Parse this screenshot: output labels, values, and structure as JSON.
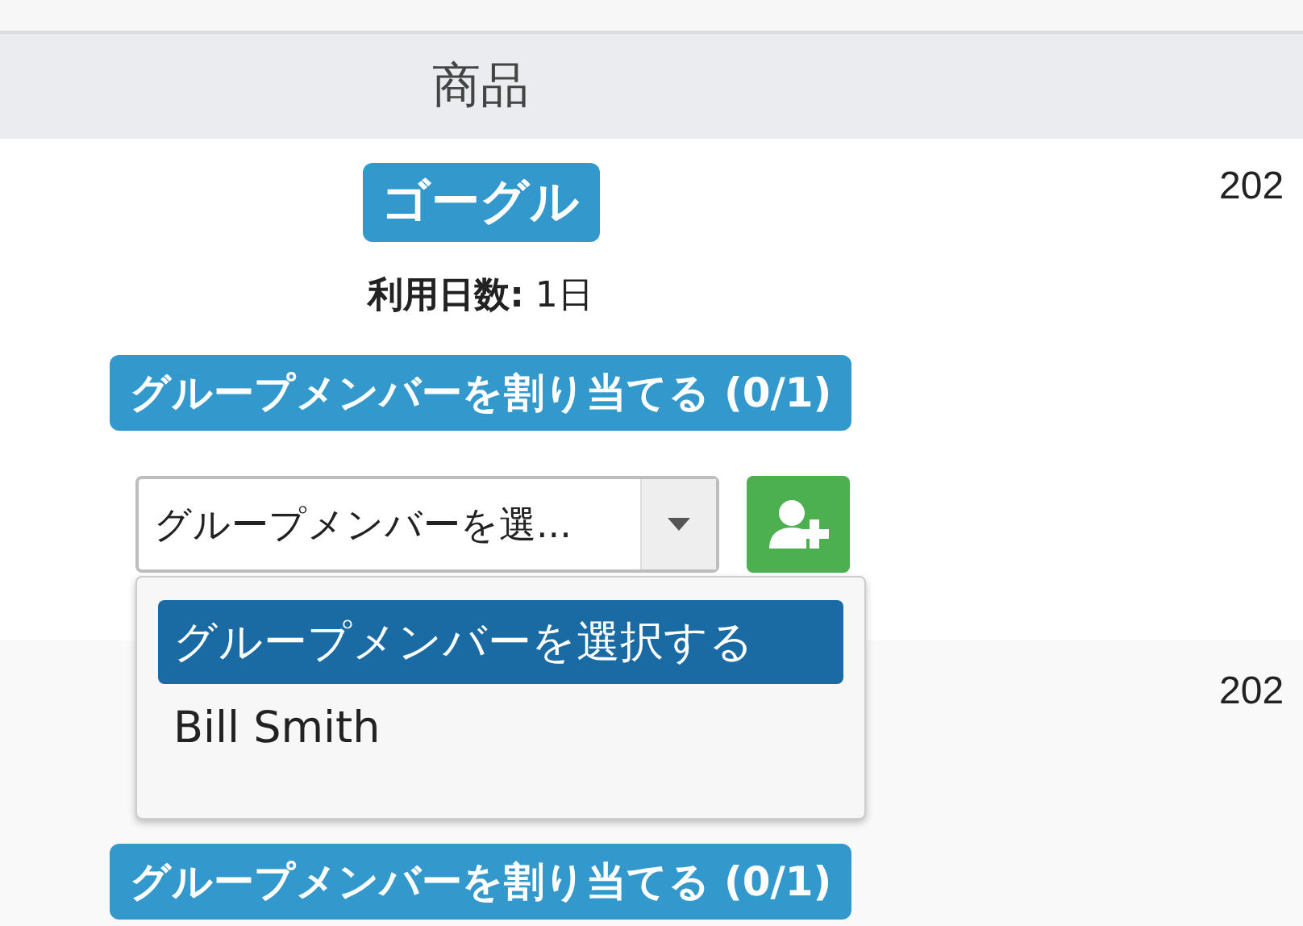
{
  "table": {
    "columns": [
      "商品"
    ],
    "rows": [
      {
        "product": "ゴーグル",
        "days_label": "利用日数:",
        "days_value": "1日",
        "assign_label": "グループメンバーを割り当てる (0/1)",
        "select": {
          "value": "グループメンバーを選...",
          "expanded": true,
          "options": [
            {
              "label": "グループメンバーを選択する",
              "selected": true
            },
            {
              "label": "Bill Smith",
              "selected": false
            }
          ]
        },
        "column_2": "202"
      },
      {
        "assign_label": "グループメンバーを割り当てる (0/1)",
        "column_2": "202"
      }
    ]
  }
}
